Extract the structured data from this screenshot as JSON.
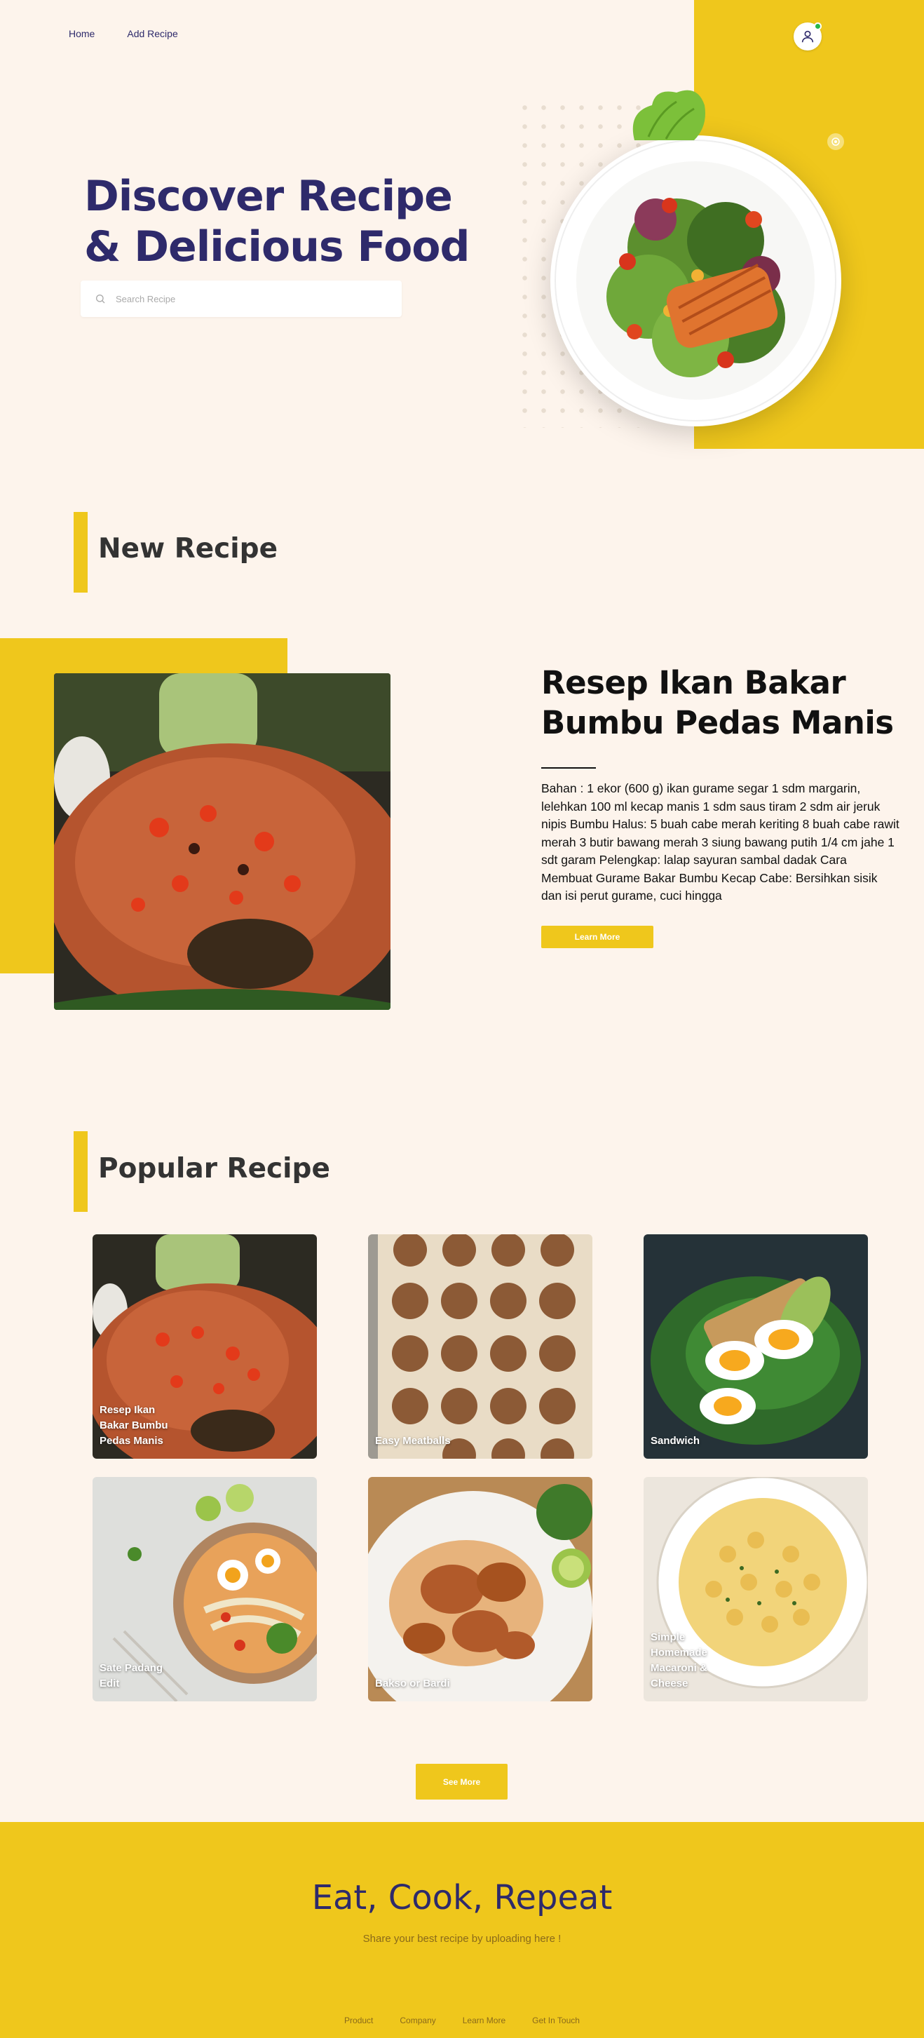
{
  "nav": {
    "items": [
      {
        "label": "Home"
      },
      {
        "label": "Add Recipe"
      }
    ]
  },
  "hero": {
    "title_line1": "Discover Recipe",
    "title_line2": "& Delicious Food",
    "search_placeholder": "Search Recipe"
  },
  "new_recipe": {
    "section_title": "New Recipe",
    "title": "Resep Ikan Bakar Bumbu Pedas Manis",
    "description": "Bahan : 1 ekor (600 g) ikan gurame segar 1 sdm margarin, lelehkan 100 ml kecap manis 1 sdm saus tiram 2 sdm air jeruk nipis Bumbu Halus: 5 buah cabe merah keriting 8 buah cabe rawit merah 3 butir bawang merah 3 siung bawang putih 1/4 cm jahe 1 sdt garam Pelengkap: lalap sayuran sambal dadak Cara Membuat Gurame Bakar Bumbu Kecap Cabe: Bersihkan sisik dan isi perut gurame, cuci hingga",
    "button_label": "Learn More"
  },
  "popular": {
    "section_title": "Popular Recipe",
    "cards": [
      {
        "label": "Resep Ikan Bakar Bumbu Pedas Manis"
      },
      {
        "label": "Easy Meatballs"
      },
      {
        "label": "Sandwich"
      },
      {
        "label": "Sate Padang Edit"
      },
      {
        "label": "Bakso or Bardi"
      },
      {
        "label": "Simple Homemade Macaroni & Cheese"
      }
    ],
    "button_label": "See More"
  },
  "footer": {
    "title": "Eat, Cook, Repeat",
    "subtitle": "Share your best recipe by uploading here !",
    "links": [
      {
        "label": "Product"
      },
      {
        "label": "Company"
      },
      {
        "label": "Learn More"
      },
      {
        "label": "Get In Touch"
      }
    ]
  },
  "colors": {
    "accent": "#efc71c",
    "brand": "#2e2a6b",
    "background": "#fdf4ec"
  },
  "icons": {
    "search": "search-icon",
    "user": "user-icon",
    "status": "online-status-icon"
  }
}
